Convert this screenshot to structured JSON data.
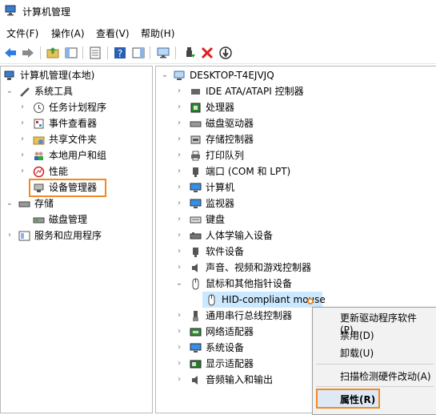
{
  "window": {
    "title": "计算机管理"
  },
  "menu": [
    "文件(F)",
    "操作(A)",
    "查看(V)",
    "帮助(H)"
  ],
  "toolbar": {
    "icons": [
      "back-arrow-icon",
      "forward-arrow-icon",
      "up-folder-icon",
      "show-tree-icon",
      "export-list-icon",
      "help-icon",
      "show-action-pane-icon",
      "scan-hardware-icon",
      "enable-device-icon",
      "uninstall-icon",
      "update-driver-icon"
    ]
  },
  "left_tree": {
    "root": "计算机管理(本地)",
    "system_tools": "系统工具",
    "items": [
      "任务计划程序",
      "事件查看器",
      "共享文件夹",
      "本地用户和组",
      "性能",
      "设备管理器"
    ],
    "storage": "存储",
    "disk_mgmt": "磁盘管理",
    "services": "服务和应用程序"
  },
  "right_tree": {
    "root": "DESKTOP-T4EJVJQ",
    "categories": [
      "IDE ATA/ATAPI 控制器",
      "处理器",
      "磁盘驱动器",
      "存储控制器",
      "打印队列",
      "端口 (COM 和 LPT)",
      "计算机",
      "监视器",
      "键盘",
      "人体学输入设备",
      "软件设备",
      "声音、视频和游戏控制器",
      "鼠标和其他指针设备"
    ],
    "selected_device": "HID-compliant mouse",
    "after": [
      "通用串行总线控制器",
      "网络适配器",
      "系统设备",
      "显示适配器",
      "音频输入和输出"
    ]
  },
  "context_menu": {
    "update_driver": "更新驱动程序软件(P)...",
    "disable": "禁用(D)",
    "uninstall": "卸载(U)",
    "scan": "扫描检测硬件改动(A)",
    "properties": "属性(R)"
  },
  "colors": {
    "highlight": "#f08a24",
    "selection": "#cce8ff"
  }
}
